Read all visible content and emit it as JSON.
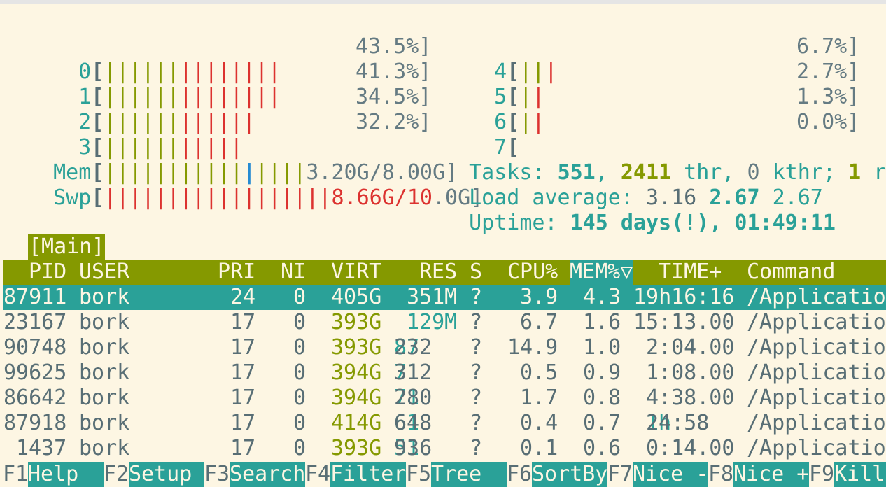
{
  "cpu_meters": [
    {
      "id": "0",
      "bars_olive": "||||||",
      "bars_red": "||||||||",
      "value": "43.5%]"
    },
    {
      "id": "1",
      "bars_olive": "||||||",
      "bars_red": "||||||||",
      "value": "41.3%]"
    },
    {
      "id": "2",
      "bars_olive": "||||||",
      "bars_red": "||||||",
      "value": "34.5%]"
    },
    {
      "id": "3",
      "bars_olive": "||||||",
      "bars_red": "|||||",
      "value": "32.2%]"
    },
    {
      "id": "4",
      "bars_olive": "||",
      "bars_red": "|",
      "value": "6.7%]"
    },
    {
      "id": "5",
      "bars_olive": "|",
      "bars_red": "|",
      "value": "2.7%]"
    },
    {
      "id": "6",
      "bars_olive": "|",
      "bars_red": "|",
      "value": "1.3%]"
    },
    {
      "id": "7",
      "bars_olive": "",
      "bars_red": "",
      "value": "0.0%]"
    }
  ],
  "mem": {
    "label": "Mem",
    "bars_a": "|||||||||||",
    "bars_b": "|",
    "bars_c": "||||",
    "used": "3.20G",
    "total": "/8.00G]"
  },
  "swp": {
    "label": "Swp",
    "bars": "||||||||||||||||||",
    "used_red": "8.66G/10",
    "rest": ".0G]"
  },
  "tasks": {
    "label": "Tasks: ",
    "count": "551",
    "sep1": ", ",
    "threads": "2411",
    "thr": " thr, ",
    "kthr_num": "0",
    "kthr": " kthr; ",
    "running": "1",
    "r": " r"
  },
  "load": {
    "label": "Load average: ",
    "l1": "3.16",
    "l5": "2.67",
    "l15": "2.67"
  },
  "uptime": {
    "label": "Uptime: ",
    "value": "145 days(!), 01:49:11"
  },
  "tab_label": "[Main]",
  "columns": {
    "pid": "PID",
    "user": "USER",
    "pri": "PRI",
    "ni": "NI",
    "virt": "VIRT",
    "res": "RES",
    "s": "S",
    "cpu": "CPU%",
    "mem": "MEM%▽",
    "time": "TIME+",
    "command": "Command"
  },
  "processes": [
    {
      "pid": "87911",
      "user": "bork",
      "pri": "24",
      "ni": "0",
      "virt": "405G",
      "res_a": "",
      "res_b": "351M",
      "s": "?",
      "cpu": "3.9",
      "mem": "4.3",
      "time_h": "",
      "time": "19h16:16",
      "command": "/Applicatio"
    },
    {
      "pid": "23167",
      "user": "bork",
      "pri": "17",
      "ni": "0",
      "virt": "393G",
      "res_a": "",
      "res_b": "129M",
      "s": "?",
      "cpu": "6.7",
      "mem": "1.6",
      "time_h": "",
      "time": "15:13.00",
      "command": "/Applicatio"
    },
    {
      "pid": "90748",
      "user": "bork",
      "pri": "17",
      "ni": "0",
      "virt": "393G",
      "res_a": "87",
      "res_b": "232",
      "s": "?",
      "cpu": "14.9",
      "mem": "1.0",
      "time_h": "",
      "time": "2:04.00",
      "command": "/Applicatio"
    },
    {
      "pid": "99625",
      "user": "bork",
      "pri": "17",
      "ni": "0",
      "virt": "394G",
      "res_a": "71",
      "res_b": "312",
      "s": "?",
      "cpu": "0.5",
      "mem": "0.9",
      "time_h": "",
      "time": "1:08.00",
      "command": "/Applicatio"
    },
    {
      "pid": "86642",
      "user": "bork",
      "pri": "17",
      "ni": "0",
      "virt": "394G",
      "res_a": "71",
      "res_b": "280",
      "s": "?",
      "cpu": "1.7",
      "mem": "0.8",
      "time_h": "",
      "time": "4:38.00",
      "command": "/Applicatio"
    },
    {
      "pid": "87918",
      "user": "bork",
      "pri": "17",
      "ni": "0",
      "virt": "414G",
      "res_a": "61",
      "res_b": "648",
      "s": "?",
      "cpu": "0.4",
      "mem": "0.7",
      "time_h": "1h",
      "time": "24:58",
      "command": "/Applicatio"
    },
    {
      "pid": "1437",
      "user": "bork",
      "pri": "17",
      "ni": "0",
      "virt": "393G",
      "res_a": "51",
      "res_b": "936",
      "s": "?",
      "cpu": "0.1",
      "mem": "0.6",
      "time_h": "",
      "time": "0:14.00",
      "command": "/Applicatio"
    }
  ],
  "fkeys": [
    {
      "key": "F1",
      "label": "Help  "
    },
    {
      "key": "F2",
      "label": "Setup "
    },
    {
      "key": "F3",
      "label": "Search"
    },
    {
      "key": "F4",
      "label": "Filter"
    },
    {
      "key": "F5",
      "label": "Tree  "
    },
    {
      "key": "F6",
      "label": "SortBy"
    },
    {
      "key": "F7",
      "label": "Nice -"
    },
    {
      "key": "F8",
      "label": "Nice +"
    },
    {
      "key": "F9",
      "label": "Kill"
    }
  ]
}
